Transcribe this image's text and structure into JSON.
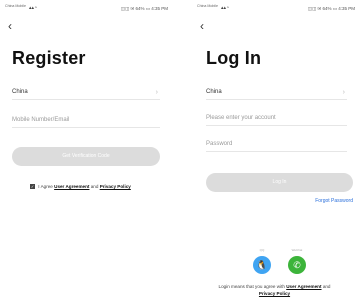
{
  "register": {
    "status": {
      "carrier": "China Mobile",
      "right": "◫◫ ✉ 64% ▭ 4:35 PM"
    },
    "back_icon": "‹",
    "title": "Register",
    "country": "China",
    "mobile_placeholder": "Mobile Number/Email",
    "get_code_label": "Get Verification Code",
    "agree_prefix": "I Agree",
    "user_agreement": "User Agreement",
    "and": "and",
    "privacy_policy": "Privacy Policy"
  },
  "login": {
    "status": {
      "carrier": "China Mobile",
      "right": "◫◫ ✉ 64% ▭ 4:35 PM"
    },
    "back_icon": "‹",
    "title": "Log In",
    "country": "China",
    "account_placeholder": "Please enter your account",
    "password_placeholder": "Password",
    "login_label": "Log In",
    "forgot_label": "Forgot Password",
    "social": [
      {
        "name": "qq",
        "icon": "🐧",
        "color": "#3fa4f2",
        "caption": "QQ"
      },
      {
        "name": "wechat",
        "icon": "✆",
        "color": "#3cb43a",
        "caption": "WeChat"
      }
    ],
    "footer_prefix": "Login means that you agree with",
    "user_agreement": "User Agreement",
    "and": "and",
    "privacy_policy": "Privacy Policy"
  }
}
